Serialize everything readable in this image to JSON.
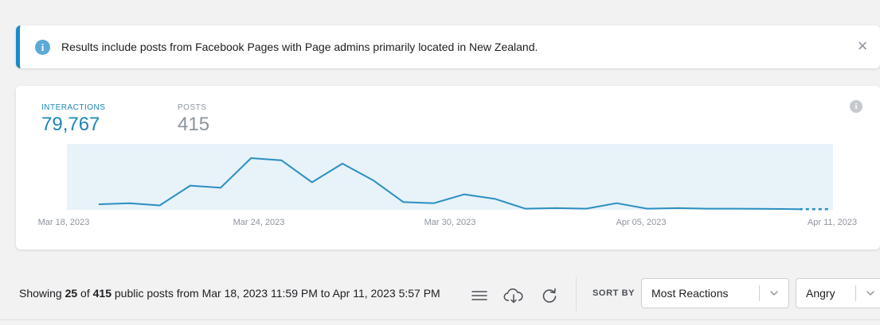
{
  "banner": {
    "text": "Results include posts from Facebook Pages with Page admins primarily located in New Zealand.",
    "info_icon": "i",
    "close_icon": "×"
  },
  "metrics": [
    {
      "label": "INTERACTIONS",
      "value": "79,767"
    },
    {
      "label": "POSTS",
      "value": "415"
    }
  ],
  "chart_info_icon": "i",
  "chart_data": {
    "type": "line",
    "title": "",
    "xlabel": "",
    "ylabel": "",
    "x_ticks": [
      "Mar 18, 2023",
      "Mar 24, 2023",
      "Mar 30, 2023",
      "Apr 05, 2023",
      "Apr 11, 2023"
    ],
    "x": [
      "Mar 18",
      "Mar 19",
      "Mar 20",
      "Mar 21",
      "Mar 22",
      "Mar 23",
      "Mar 24",
      "Mar 25",
      "Mar 26",
      "Mar 27",
      "Mar 28",
      "Mar 29",
      "Mar 30",
      "Mar 31",
      "Apr 01",
      "Apr 02",
      "Apr 03",
      "Apr 04",
      "Apr 05",
      "Apr 06",
      "Apr 07",
      "Apr 08",
      "Apr 09",
      "Apr 10",
      "Apr 11"
    ],
    "series": [
      {
        "values": [
          5,
          6,
          4,
          22,
          20,
          47,
          45,
          25,
          42,
          27,
          7,
          6,
          14,
          10,
          1,
          1.5,
          1,
          6,
          1,
          1.5,
          1,
          1,
          0.8,
          0.5,
          0.5
        ]
      }
    ],
    "ylim": [
      0,
      60
    ],
    "line_color": "#2b8fc2",
    "fill_color": "#e7f2f9",
    "grid": false
  },
  "toolbar": {
    "showing_prefix": "Showing ",
    "count_shown": "25",
    "of_text": " of ",
    "total": "415",
    "suffix": " public posts from Mar 18, 2023 11:59 PM to Apr 11, 2023 5:57 PM",
    "icons": [
      "list-icon",
      "cloud-download-icon",
      "refresh-icon"
    ],
    "sort_by_label": "SORT BY",
    "sort_value": "Most Reactions",
    "reaction_value": "Angry"
  }
}
